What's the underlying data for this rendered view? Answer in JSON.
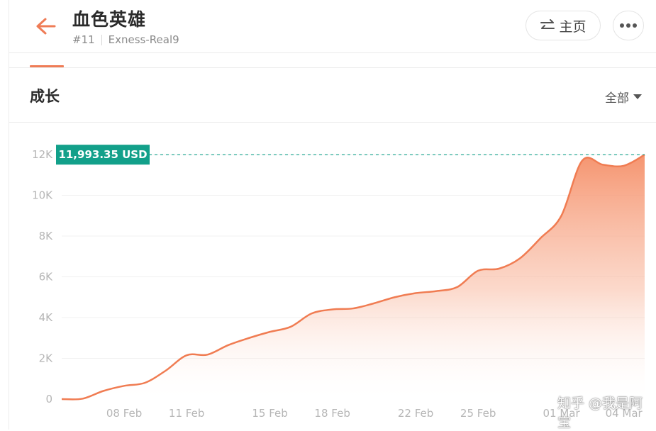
{
  "header": {
    "back_icon": "arrow-left-icon",
    "title": "血色英雄",
    "rank": "#11",
    "account": "Exness-Real9",
    "home_label": "主页",
    "home_icon": "swap-arrows-icon",
    "more_icon": "more-dots-icon"
  },
  "section": {
    "title": "成长",
    "range_label": "全部",
    "range_icon": "caret-down-icon"
  },
  "colors": {
    "accent": "#ef7c56",
    "line": "#f07c52",
    "label_bg": "#12a08a",
    "dashed": "#12a08a"
  },
  "chart_data": {
    "type": "area",
    "value_label": "11,993.35 USD",
    "current_value": 11993.35,
    "y_ticks": [
      "0",
      "2K",
      "4K",
      "6K",
      "8K",
      "10K",
      "12K"
    ],
    "ylim": [
      0,
      12000
    ],
    "x_ticks": [
      "08 Feb",
      "11 Feb",
      "15 Feb",
      "18 Feb",
      "22 Feb",
      "25 Feb",
      "01 Mar",
      "04 Mar"
    ],
    "grid": true,
    "series": [
      {
        "x": [
          "05 Feb",
          "06 Feb",
          "07 Feb",
          "08 Feb",
          "09 Feb",
          "10 Feb",
          "11 Feb",
          "12 Feb",
          "13 Feb",
          "14 Feb",
          "15 Feb",
          "16 Feb",
          "17 Feb",
          "18 Feb",
          "19 Feb",
          "20 Feb",
          "21 Feb",
          "22 Feb",
          "23 Feb",
          "24 Feb",
          "25 Feb",
          "26 Feb",
          "27 Feb",
          "28 Feb",
          "01 Mar",
          "02 Mar",
          "03 Mar",
          "04 Mar",
          "05 Mar"
        ],
        "values": [
          0,
          20,
          400,
          650,
          800,
          1400,
          2150,
          2180,
          2650,
          3000,
          3300,
          3550,
          4200,
          4400,
          4450,
          4700,
          5000,
          5200,
          5300,
          5500,
          6300,
          6400,
          6900,
          7900,
          9000,
          11700,
          11500,
          11450,
          11993
        ]
      }
    ]
  },
  "watermark": "知乎 @我是阿宝"
}
